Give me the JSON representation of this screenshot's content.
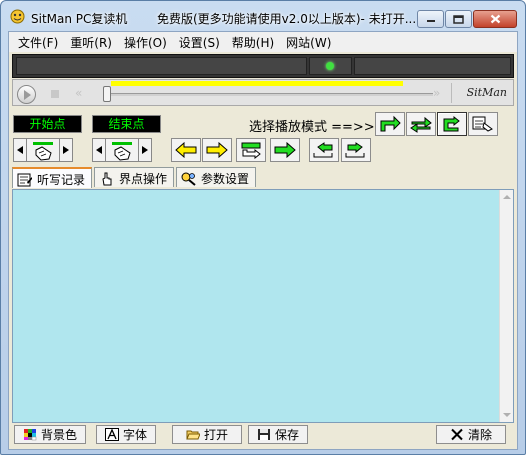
{
  "window": {
    "title": "SitMan PC复读机",
    "subtitle": "免费版(更多功能请使用v2.0以上版本)- 未打开..."
  },
  "menu": [
    {
      "label": "文件(F)",
      "name": "menu-file"
    },
    {
      "label": "重听(R)",
      "name": "menu-relisten"
    },
    {
      "label": "操作(O)",
      "name": "menu-operation"
    },
    {
      "label": "设置(S)",
      "name": "menu-settings"
    },
    {
      "label": "帮助(H)",
      "name": "menu-help"
    },
    {
      "label": "网站(W)",
      "name": "menu-website"
    }
  ],
  "player": {
    "logo": "SitMan",
    "rewind_glyph": "«",
    "forward_glyph": "»",
    "position": 0,
    "indicator_color": "#40e040",
    "lcd_color": "#353535",
    "bar_color": "#ffff00"
  },
  "points": {
    "start_label": "开始点",
    "end_label": "结束点",
    "label_color": "#00ff00"
  },
  "mode": {
    "label": "选择播放模式 ==>>",
    "selected": "mode-single-loop-icon",
    "icons": [
      "mode-single-play-icon",
      "mode-loop-icon",
      "mode-repeat-loop-icon",
      "mode-follow-read-icon"
    ]
  },
  "tabs": [
    {
      "label": "听写记录",
      "name": "tab-dictation",
      "active": true,
      "icon": "notepad-icon"
    },
    {
      "label": "界点操作",
      "name": "tab-point-ops",
      "active": false,
      "icon": "hand-icon"
    },
    {
      "label": "参数设置",
      "name": "tab-params",
      "active": false,
      "icon": "settings-icon"
    }
  ],
  "editor": {
    "value": "",
    "background": "#b0e6ee"
  },
  "bottom": {
    "bgcolor_label": "背景色",
    "font_label": "字体",
    "open_label": "打开",
    "save_label": "保存",
    "clear_label": "清除"
  }
}
